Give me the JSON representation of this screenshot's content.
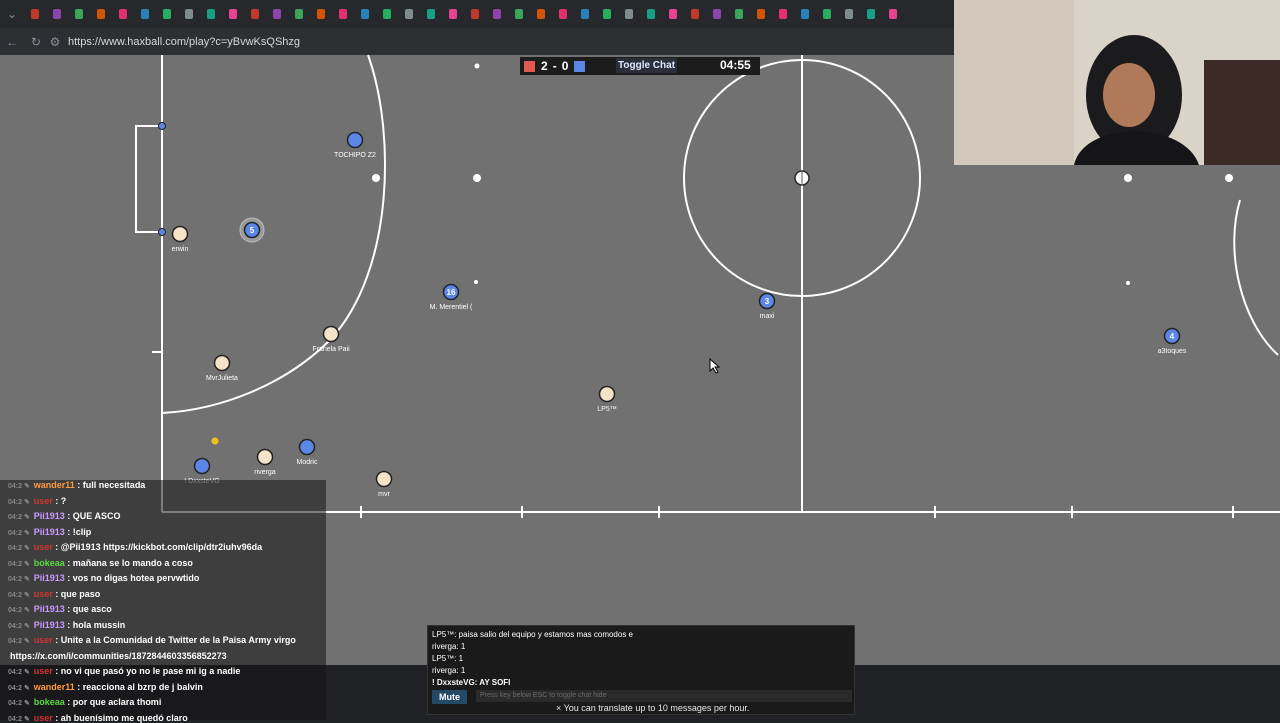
{
  "browser": {
    "url": "https://www.haxball.com/play?c=yBvwKsQShzg"
  },
  "game": {
    "score_red": "2",
    "score_dash": "-",
    "score_blue": "0",
    "toggle_chat": "Toggle Chat",
    "timer": "04:55",
    "colors": {
      "red": "#e05a4f",
      "blue": "#5b86e5",
      "pitch": "#717171"
    },
    "players": [
      {
        "team": "blue",
        "number": "",
        "name": "TOCHIPO Z2"
      },
      {
        "team": "red",
        "number": "",
        "name": "erwin"
      },
      {
        "team": "blue",
        "number": "5",
        "name": ""
      },
      {
        "team": "blue",
        "number": "16",
        "name": "M. Merentiel ("
      },
      {
        "team": "red",
        "number": "",
        "name": "Franela Paii"
      },
      {
        "team": "red",
        "number": "",
        "name": "MvrJulieta"
      },
      {
        "team": "blue",
        "number": "3",
        "name": "maxi"
      },
      {
        "team": "blue",
        "number": "4",
        "name": "a3toques"
      },
      {
        "team": "red",
        "number": "",
        "name": "LP5™"
      },
      {
        "team": "blue",
        "number": "",
        "name": "Modric"
      },
      {
        "team": "red",
        "number": "",
        "name": "riverga"
      },
      {
        "team": "blue",
        "number": "",
        "name": "! DxxsteVG"
      },
      {
        "team": "red",
        "number": "",
        "name": "mvr"
      }
    ]
  },
  "stream_chat": [
    {
      "user": "wander11",
      "user_color": "#ff9a3c",
      "text": ": full necesitada"
    },
    {
      "user": "user",
      "user_color": "#d23434",
      "text": ": ?"
    },
    {
      "user": "Pii1913",
      "user_color": "#c79bff",
      "text": ": QUE ASCO"
    },
    {
      "user": "Pii1913",
      "user_color": "#c79bff",
      "text": ": !clip"
    },
    {
      "user": "user",
      "user_color": "#d23434",
      "text": ": @Pii1913 https://kickbot.com/clip/dtr2iuhv96da"
    },
    {
      "user": "bokeaa",
      "user_color": "#5bdc3e",
      "text": ": mañana se lo mando a coso"
    },
    {
      "user": "Pii1913",
      "user_color": "#c79bff",
      "text": ": vos no digas hotea pervwtido"
    },
    {
      "user": "user",
      "user_color": "#d23434",
      "text": ": que paso"
    },
    {
      "user": "Pii1913",
      "user_color": "#c79bff",
      "text": ": que asco"
    },
    {
      "user": "Pii1913",
      "user_color": "#c79bff",
      "text": ": hola mussin"
    },
    {
      "user": "user",
      "user_color": "#d23434",
      "text": ": Unite a la Comunidad de Twitter de la Paisa Army virgo"
    },
    {
      "user": "",
      "user_color": "#ffffff",
      "text": "https://x.com/i/communities/1872844603356852273"
    },
    {
      "user": "user",
      "user_color": "#d23434",
      "text": ": no vi que pasó yo no le pase mi ig a nadie"
    },
    {
      "user": "wander11",
      "user_color": "#ff9a3c",
      "text": ": reacciona al bzrp de j balvin"
    },
    {
      "user": "bokeaa",
      "user_color": "#5bdc3e",
      "text": ": por que aclara thomi"
    },
    {
      "user": "user",
      "user_color": "#d23434",
      "text": ": ah buenísimo me quedó claro"
    }
  ],
  "haxball_chat": {
    "messages": [
      "LP5™: paisa salio del equipo y estamos mas comodos e",
      "riverga: 1",
      "LP5™: 1",
      "riverga: 1",
      "! DxxsteVG: AY SOFI"
    ],
    "mute_label": "Mute",
    "input_hint": "Press key below ESC to toggle chat hide"
  },
  "translate_note": "× You can translate up to 10 messages per hour."
}
